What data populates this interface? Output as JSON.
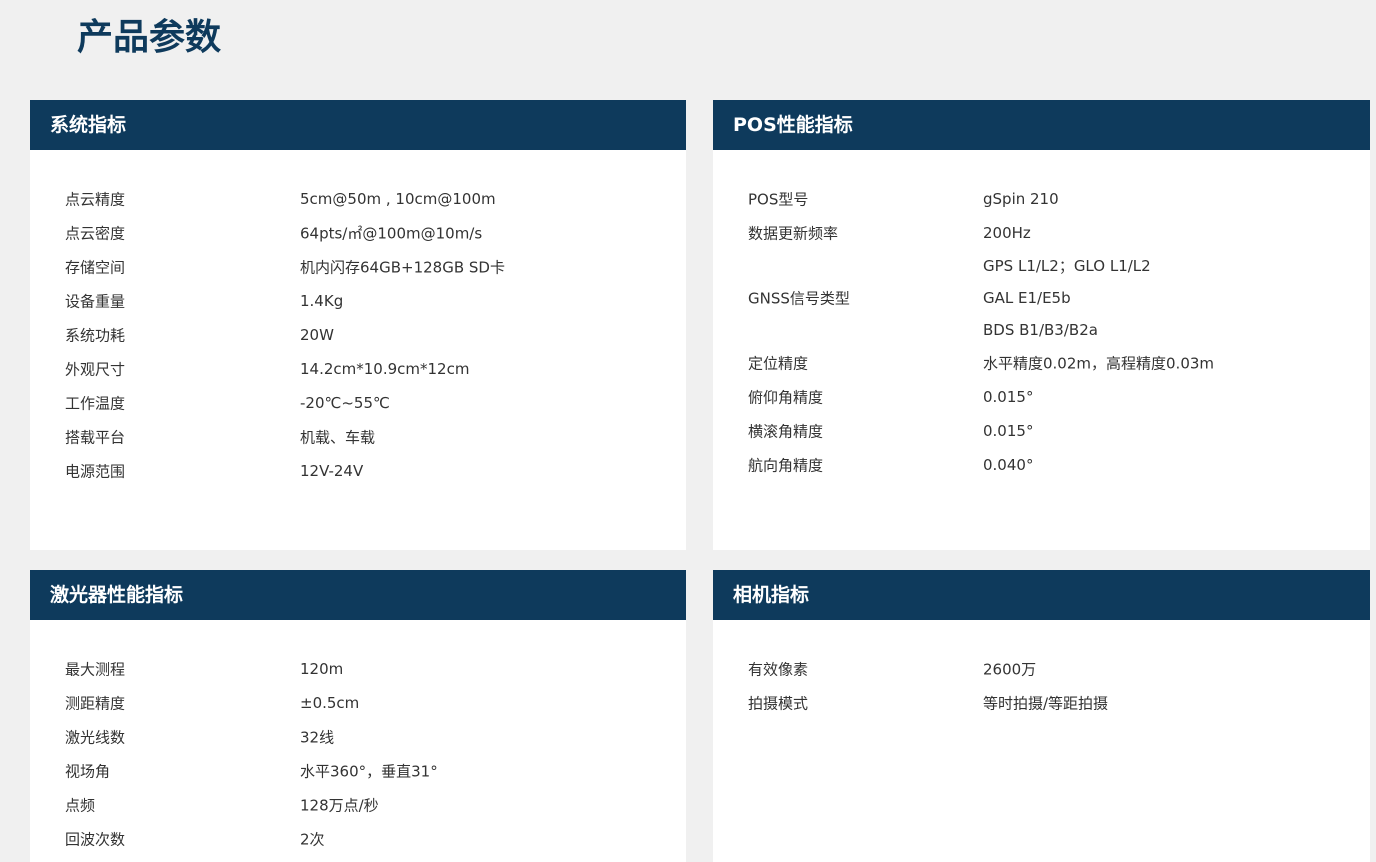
{
  "page_title": "产品参数",
  "system": {
    "title": "系统指标",
    "rows": [
      {
        "label": "点云精度",
        "value": "5cm@50m , 10cm@100m"
      },
      {
        "label": "点云密度",
        "value": "64pts/㎡@100m@10m/s"
      },
      {
        "label": "存储空间",
        "value": "机内闪存64GB+128GB SD卡"
      },
      {
        "label": "设备重量",
        "value": "1.4Kg"
      },
      {
        "label": "系统功耗",
        "value": "20W"
      },
      {
        "label": "外观尺寸",
        "value": "14.2cm*10.9cm*12cm"
      },
      {
        "label": "工作温度",
        "value": "-20℃~55℃"
      },
      {
        "label": "搭载平台",
        "value": "机载、车载"
      },
      {
        "label": "电源范围",
        "value": "12V-24V"
      }
    ]
  },
  "pos": {
    "title": "POS性能指标",
    "rows": [
      {
        "label": "POS型号",
        "value": "gSpin 210"
      },
      {
        "label": "数据更新频率",
        "value": "200Hz"
      }
    ],
    "gnss": {
      "label": "GNSS信号类型",
      "values": [
        "GPS L1/L2；GLO L1/L2",
        "GAL E1/E5b",
        "BDS B1/B3/B2a"
      ]
    },
    "rows2": [
      {
        "label": "定位精度",
        "value": "水平精度0.02m，高程精度0.03m"
      },
      {
        "label": "俯仰角精度",
        "value": "0.015°"
      },
      {
        "label": "横滚角精度",
        "value": "0.015°"
      },
      {
        "label": "航向角精度",
        "value": "0.040°"
      }
    ]
  },
  "laser": {
    "title": "激光器性能指标",
    "rows": [
      {
        "label": "最大测程",
        "value": "120m"
      },
      {
        "label": "测距精度",
        "value": "±0.5cm"
      },
      {
        "label": "激光线数",
        "value": "32线"
      },
      {
        "label": "视场角",
        "value": "水平360°，垂直31°"
      },
      {
        "label": "点频",
        "value": "128万点/秒"
      },
      {
        "label": "回波次数",
        "value": "2次"
      }
    ]
  },
  "camera": {
    "title": "相机指标",
    "rows": [
      {
        "label": "有效像素",
        "value": "2600万"
      },
      {
        "label": "拍摄模式",
        "value": "等时拍摄/等距拍摄"
      }
    ]
  }
}
